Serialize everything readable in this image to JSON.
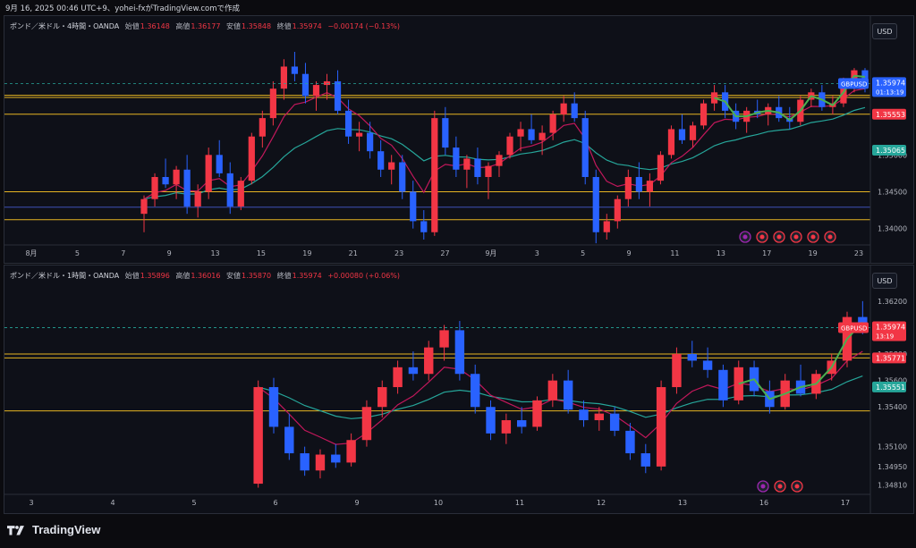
{
  "header": {
    "caption": "9月 16, 2025 00:46 UTC+9、yohei-fxがTradingView.comで作成"
  },
  "footer": {
    "brand": "TradingView"
  },
  "colors": {
    "up": "#f23645",
    "down": "#2962ff",
    "ema_fast": "#c2185b",
    "ema_slow": "#26a69a",
    "level": "#e6b422",
    "level2": "#3f51b5",
    "marker_green": "#4caf50"
  },
  "panels": [
    {
      "id": "h4",
      "title": "ポンド／米ドル・4時間・OANDA",
      "ohlc": {
        "open_label": "始値",
        "open": "1.36148",
        "high_label": "高値",
        "high": "1.36177",
        "low_label": "安値",
        "low": "1.35848",
        "close_label": "終値",
        "close": "1.35974",
        "change": "−0.00174 (−0.13%)"
      },
      "currency_button": "USD",
      "symbol_tag": "GBPUSD",
      "price_tag": "1.35974",
      "countdown": "01:13:19",
      "level_tags": [
        {
          "value": "1.35553",
          "color": "#f23645"
        },
        {
          "value": "1.35065",
          "color": "#26a69a"
        }
      ],
      "y_ticks": [
        "1.35000",
        "1.34500",
        "1.34000"
      ],
      "x_ticks": [
        "8月",
        "5",
        "7",
        "9",
        "13",
        "15",
        "19",
        "21",
        "23",
        "27",
        "9月",
        "3",
        "5",
        "9",
        "11",
        "13",
        "17",
        "19",
        "23"
      ],
      "legend_icons": [
        "lightning-icon",
        "flag-icon",
        "flag-icon",
        "flag-icon",
        "flag-icon",
        "flag-icon"
      ]
    },
    {
      "id": "h1",
      "title": "ポンド／米ドル・1時間・OANDA",
      "ohlc": {
        "open_label": "始値",
        "open": "1.35896",
        "high_label": "高値",
        "high": "1.36016",
        "low_label": "安値",
        "low": "1.35870",
        "close_label": "終値",
        "close": "1.35974",
        "change": "+0.00080 (+0.06%)"
      },
      "currency_button": "USD",
      "symbol_tag": "GBPUSD",
      "price_tag": "1.35974",
      "countdown": "13:19",
      "level_tags": [
        {
          "value": "1.35771",
          "color": "#f23645"
        },
        {
          "value": "1.35551",
          "color": "#26a69a"
        }
      ],
      "y_ticks": [
        "1.36200",
        "1.35800",
        "1.35600",
        "1.35400",
        "1.35100",
        "1.34950",
        "1.34810"
      ],
      "x_ticks": [
        "3",
        "4",
        "5",
        "6",
        "9",
        "10",
        "11",
        "12",
        "13",
        "16",
        "17"
      ],
      "legend_icons": [
        "lightning-icon",
        "flag-icon",
        "flag-icon"
      ]
    }
  ],
  "chart_data": [
    {
      "type": "candlestick",
      "title": "ポンド／米ドル・4時間・OANDA",
      "ylim": [
        1.3385,
        1.364
      ],
      "horizontal_levels": [
        1.3581,
        1.3578,
        1.35553,
        1.345,
        1.3429,
        1.3412
      ],
      "ema_fast_last": 1.35553,
      "ema_slow_last": 1.35065,
      "series": [
        {
          "o": 1.342,
          "h": 1.3445,
          "l": 1.3395,
          "c": 1.344
        },
        {
          "o": 1.344,
          "h": 1.3475,
          "l": 1.343,
          "c": 1.347
        },
        {
          "o": 1.347,
          "h": 1.3495,
          "l": 1.3455,
          "c": 1.346
        },
        {
          "o": 1.346,
          "h": 1.3485,
          "l": 1.344,
          "c": 1.348
        },
        {
          "o": 1.348,
          "h": 1.35,
          "l": 1.342,
          "c": 1.343
        },
        {
          "o": 1.343,
          "h": 1.346,
          "l": 1.3415,
          "c": 1.345
        },
        {
          "o": 1.345,
          "h": 1.351,
          "l": 1.344,
          "c": 1.35
        },
        {
          "o": 1.35,
          "h": 1.352,
          "l": 1.347,
          "c": 1.3475
        },
        {
          "o": 1.3475,
          "h": 1.349,
          "l": 1.342,
          "c": 1.343
        },
        {
          "o": 1.343,
          "h": 1.347,
          "l": 1.3425,
          "c": 1.3465
        },
        {
          "o": 1.3465,
          "h": 1.353,
          "l": 1.346,
          "c": 1.3525
        },
        {
          "o": 1.3525,
          "h": 1.356,
          "l": 1.351,
          "c": 1.355
        },
        {
          "o": 1.355,
          "h": 1.36,
          "l": 1.354,
          "c": 1.359
        },
        {
          "o": 1.359,
          "h": 1.363,
          "l": 1.3575,
          "c": 1.362
        },
        {
          "o": 1.362,
          "h": 1.364,
          "l": 1.36,
          "c": 1.361
        },
        {
          "o": 1.361,
          "h": 1.3625,
          "l": 1.357,
          "c": 1.358
        },
        {
          "o": 1.358,
          "h": 1.36,
          "l": 1.356,
          "c": 1.3595
        },
        {
          "o": 1.3595,
          "h": 1.361,
          "l": 1.3575,
          "c": 1.36
        },
        {
          "o": 1.36,
          "h": 1.3615,
          "l": 1.3555,
          "c": 1.356
        },
        {
          "o": 1.356,
          "h": 1.3575,
          "l": 1.3515,
          "c": 1.3525
        },
        {
          "o": 1.3525,
          "h": 1.3545,
          "l": 1.3505,
          "c": 1.353
        },
        {
          "o": 1.353,
          "h": 1.3545,
          "l": 1.3495,
          "c": 1.3505
        },
        {
          "o": 1.3505,
          "h": 1.352,
          "l": 1.347,
          "c": 1.348
        },
        {
          "o": 1.348,
          "h": 1.35,
          "l": 1.346,
          "c": 1.349
        },
        {
          "o": 1.349,
          "h": 1.35,
          "l": 1.344,
          "c": 1.345
        },
        {
          "o": 1.345,
          "h": 1.3465,
          "l": 1.34,
          "c": 1.341
        },
        {
          "o": 1.341,
          "h": 1.3425,
          "l": 1.3385,
          "c": 1.3395
        },
        {
          "o": 1.3395,
          "h": 1.356,
          "l": 1.339,
          "c": 1.355
        },
        {
          "o": 1.355,
          "h": 1.3565,
          "l": 1.35,
          "c": 1.351
        },
        {
          "o": 1.351,
          "h": 1.3525,
          "l": 1.347,
          "c": 1.348
        },
        {
          "o": 1.348,
          "h": 1.35,
          "l": 1.3455,
          "c": 1.3495
        },
        {
          "o": 1.3495,
          "h": 1.351,
          "l": 1.346,
          "c": 1.347
        },
        {
          "o": 1.347,
          "h": 1.349,
          "l": 1.344,
          "c": 1.3485
        },
        {
          "o": 1.3485,
          "h": 1.3505,
          "l": 1.347,
          "c": 1.35
        },
        {
          "o": 1.35,
          "h": 1.353,
          "l": 1.3495,
          "c": 1.3525
        },
        {
          "o": 1.3525,
          "h": 1.3545,
          "l": 1.3505,
          "c": 1.3535
        },
        {
          "o": 1.3535,
          "h": 1.3555,
          "l": 1.3515,
          "c": 1.352
        },
        {
          "o": 1.352,
          "h": 1.354,
          "l": 1.35,
          "c": 1.353
        },
        {
          "o": 1.353,
          "h": 1.356,
          "l": 1.352,
          "c": 1.3555
        },
        {
          "o": 1.3555,
          "h": 1.358,
          "l": 1.3545,
          "c": 1.357
        },
        {
          "o": 1.357,
          "h": 1.3585,
          "l": 1.3545,
          "c": 1.355
        },
        {
          "o": 1.355,
          "h": 1.356,
          "l": 1.346,
          "c": 1.347
        },
        {
          "o": 1.347,
          "h": 1.348,
          "l": 1.338,
          "c": 1.3395
        },
        {
          "o": 1.3395,
          "h": 1.342,
          "l": 1.3385,
          "c": 1.341
        },
        {
          "o": 1.341,
          "h": 1.3445,
          "l": 1.34,
          "c": 1.344
        },
        {
          "o": 1.344,
          "h": 1.348,
          "l": 1.343,
          "c": 1.347
        },
        {
          "o": 1.347,
          "h": 1.349,
          "l": 1.344,
          "c": 1.345
        },
        {
          "o": 1.345,
          "h": 1.3475,
          "l": 1.343,
          "c": 1.3465
        },
        {
          "o": 1.3465,
          "h": 1.3505,
          "l": 1.346,
          "c": 1.35
        },
        {
          "o": 1.35,
          "h": 1.354,
          "l": 1.3495,
          "c": 1.3535
        },
        {
          "o": 1.3535,
          "h": 1.3555,
          "l": 1.3515,
          "c": 1.352
        },
        {
          "o": 1.352,
          "h": 1.3545,
          "l": 1.351,
          "c": 1.354
        },
        {
          "o": 1.354,
          "h": 1.3575,
          "l": 1.3535,
          "c": 1.357
        },
        {
          "o": 1.357,
          "h": 1.3595,
          "l": 1.356,
          "c": 1.3585
        },
        {
          "o": 1.3585,
          "h": 1.3595,
          "l": 1.355,
          "c": 1.356
        },
        {
          "o": 1.356,
          "h": 1.357,
          "l": 1.3535,
          "c": 1.3545
        },
        {
          "o": 1.3545,
          "h": 1.3565,
          "l": 1.353,
          "c": 1.356
        },
        {
          "o": 1.356,
          "h": 1.3575,
          "l": 1.355,
          "c": 1.3555
        },
        {
          "o": 1.3555,
          "h": 1.357,
          "l": 1.354,
          "c": 1.3565
        },
        {
          "o": 1.3565,
          "h": 1.358,
          "l": 1.3545,
          "c": 1.355
        },
        {
          "o": 1.355,
          "h": 1.3565,
          "l": 1.3535,
          "c": 1.3545
        },
        {
          "o": 1.3545,
          "h": 1.358,
          "l": 1.354,
          "c": 1.3575
        },
        {
          "o": 1.3575,
          "h": 1.359,
          "l": 1.3565,
          "c": 1.3585
        },
        {
          "o": 1.3585,
          "h": 1.3595,
          "l": 1.356,
          "c": 1.3565
        },
        {
          "o": 1.3565,
          "h": 1.358,
          "l": 1.3555,
          "c": 1.357
        },
        {
          "o": 1.357,
          "h": 1.3605,
          "l": 1.3565,
          "c": 1.36
        },
        {
          "o": 1.36,
          "h": 1.3618,
          "l": 1.3585,
          "c": 1.3615
        },
        {
          "o": 1.3615,
          "h": 1.3618,
          "l": 1.3585,
          "c": 1.3597
        }
      ]
    },
    {
      "type": "candlestick",
      "title": "ポンド／米ドル・1時間・OANDA",
      "ylim": [
        1.3478,
        1.3628
      ],
      "horizontal_levels": [
        1.358,
        1.35771,
        1.3537
      ],
      "ema_fast_last": 1.35771,
      "ema_slow_last": 1.35551,
      "series": [
        {
          "o": 1.3482,
          "h": 1.356,
          "l": 1.3479,
          "c": 1.3555
        },
        {
          "o": 1.3555,
          "h": 1.3562,
          "l": 1.352,
          "c": 1.3525
        },
        {
          "o": 1.3525,
          "h": 1.3535,
          "l": 1.35,
          "c": 1.3505
        },
        {
          "o": 1.3505,
          "h": 1.351,
          "l": 1.3488,
          "c": 1.3492
        },
        {
          "o": 1.3492,
          "h": 1.3508,
          "l": 1.3486,
          "c": 1.3504
        },
        {
          "o": 1.3504,
          "h": 1.3512,
          "l": 1.3494,
          "c": 1.3498
        },
        {
          "o": 1.3498,
          "h": 1.352,
          "l": 1.3495,
          "c": 1.3515
        },
        {
          "o": 1.3515,
          "h": 1.3545,
          "l": 1.351,
          "c": 1.354
        },
        {
          "o": 1.354,
          "h": 1.356,
          "l": 1.3532,
          "c": 1.3555
        },
        {
          "o": 1.3555,
          "h": 1.3575,
          "l": 1.355,
          "c": 1.357
        },
        {
          "o": 1.357,
          "h": 1.3582,
          "l": 1.356,
          "c": 1.3565
        },
        {
          "o": 1.3565,
          "h": 1.359,
          "l": 1.356,
          "c": 1.3585
        },
        {
          "o": 1.3585,
          "h": 1.3602,
          "l": 1.3575,
          "c": 1.3598
        },
        {
          "o": 1.3598,
          "h": 1.3605,
          "l": 1.356,
          "c": 1.3565
        },
        {
          "o": 1.3565,
          "h": 1.3572,
          "l": 1.3535,
          "c": 1.354
        },
        {
          "o": 1.354,
          "h": 1.3545,
          "l": 1.3515,
          "c": 1.352
        },
        {
          "o": 1.352,
          "h": 1.3535,
          "l": 1.3512,
          "c": 1.353
        },
        {
          "o": 1.353,
          "h": 1.354,
          "l": 1.352,
          "c": 1.3525
        },
        {
          "o": 1.3525,
          "h": 1.3548,
          "l": 1.3522,
          "c": 1.3545
        },
        {
          "o": 1.3545,
          "h": 1.3565,
          "l": 1.354,
          "c": 1.356
        },
        {
          "o": 1.356,
          "h": 1.3568,
          "l": 1.3535,
          "c": 1.3538
        },
        {
          "o": 1.3538,
          "h": 1.3545,
          "l": 1.3525,
          "c": 1.353
        },
        {
          "o": 1.353,
          "h": 1.354,
          "l": 1.3522,
          "c": 1.3535
        },
        {
          "o": 1.3535,
          "h": 1.354,
          "l": 1.3518,
          "c": 1.3522
        },
        {
          "o": 1.3522,
          "h": 1.3528,
          "l": 1.35,
          "c": 1.3505
        },
        {
          "o": 1.3505,
          "h": 1.3512,
          "l": 1.349,
          "c": 1.3495
        },
        {
          "o": 1.3495,
          "h": 1.356,
          "l": 1.3492,
          "c": 1.3555
        },
        {
          "o": 1.3555,
          "h": 1.3585,
          "l": 1.355,
          "c": 1.358
        },
        {
          "o": 1.358,
          "h": 1.359,
          "l": 1.357,
          "c": 1.3575
        },
        {
          "o": 1.3575,
          "h": 1.3585,
          "l": 1.3562,
          "c": 1.3568
        },
        {
          "o": 1.3568,
          "h": 1.3572,
          "l": 1.354,
          "c": 1.3545
        },
        {
          "o": 1.3545,
          "h": 1.3575,
          "l": 1.3542,
          "c": 1.357
        },
        {
          "o": 1.357,
          "h": 1.3575,
          "l": 1.3548,
          "c": 1.3552
        },
        {
          "o": 1.3552,
          "h": 1.356,
          "l": 1.3535,
          "c": 1.354
        },
        {
          "o": 1.354,
          "h": 1.3565,
          "l": 1.3538,
          "c": 1.356
        },
        {
          "o": 1.356,
          "h": 1.3572,
          "l": 1.3548,
          "c": 1.355
        },
        {
          "o": 1.355,
          "h": 1.3568,
          "l": 1.3546,
          "c": 1.3565
        },
        {
          "o": 1.3565,
          "h": 1.358,
          "l": 1.356,
          "c": 1.3575
        },
        {
          "o": 1.3575,
          "h": 1.3612,
          "l": 1.357,
          "c": 1.3608
        },
        {
          "o": 1.3608,
          "h": 1.362,
          "l": 1.3595,
          "c": 1.36
        }
      ]
    }
  ]
}
